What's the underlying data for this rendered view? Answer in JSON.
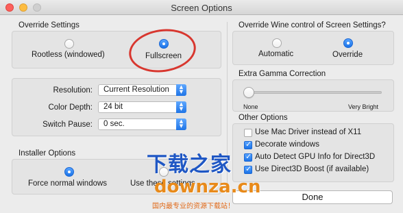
{
  "window": {
    "title": "Screen Options"
  },
  "override_settings": {
    "heading": "Override Settings",
    "options": [
      {
        "label": "Rootless (windowed)",
        "selected": false
      },
      {
        "label": "Fullscreen",
        "selected": true
      }
    ]
  },
  "display": {
    "resolution": {
      "label": "Resolution:",
      "value": "Current Resolution"
    },
    "color_depth": {
      "label": "Color Depth:",
      "value": "24 bit"
    },
    "switch_pause": {
      "label": "Switch Pause:",
      "value": "0 sec."
    }
  },
  "installer_options": {
    "heading": "Installer Options",
    "options": [
      {
        "label": "Force normal windows",
        "selected": true
      },
      {
        "label": "Use these settings",
        "selected": false
      }
    ]
  },
  "wine_control": {
    "heading": "Override Wine control of Screen Settings?",
    "options": [
      {
        "label": "Automatic",
        "selected": false
      },
      {
        "label": "Override",
        "selected": true
      }
    ]
  },
  "gamma": {
    "heading": "Extra Gamma Correction",
    "min_label": "None",
    "max_label": "Very Bright",
    "value": 0
  },
  "other_options": {
    "heading": "Other Options",
    "items": [
      {
        "label": "Use Mac Driver instead of X11",
        "checked": false
      },
      {
        "label": "Decorate windows",
        "checked": true
      },
      {
        "label": "Auto Detect GPU Info for Direct3D",
        "checked": true
      },
      {
        "label": "Use Direct3D Boost (if available)",
        "checked": true
      }
    ]
  },
  "done_label": "Done",
  "watermark": {
    "line1": "下载之家",
    "line2": "downza.cn",
    "line3": "国内最专业的资源下载站！"
  },
  "colors": {
    "accent": "#1a73e8",
    "annotation": "#d8372f",
    "watermark_blue": "#1f57c4",
    "watermark_orange": "#e88a1a"
  }
}
